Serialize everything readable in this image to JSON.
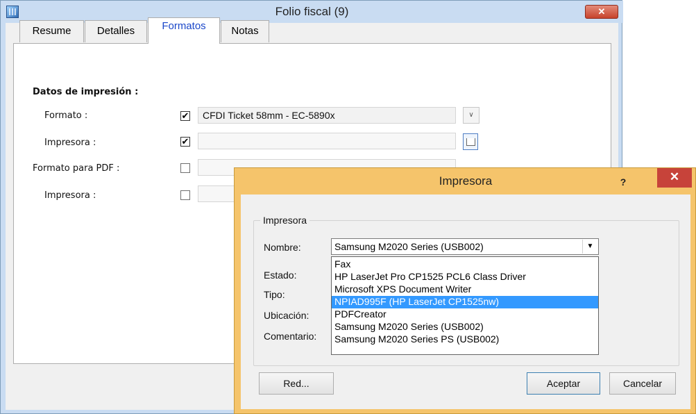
{
  "main_window": {
    "title": "Folio fiscal (9)",
    "close_glyph": "✕",
    "tabs": [
      {
        "label": "Resume",
        "active": false
      },
      {
        "label": "Detalles",
        "active": false
      },
      {
        "label": "Formatos",
        "active": true
      },
      {
        "label": "Notas",
        "active": false
      }
    ],
    "section_title": "Datos de impresión :",
    "rows": [
      {
        "label": "Formato :",
        "checked": true,
        "value": "CFDI Ticket 58mm - EC-5890x"
      },
      {
        "label": "Impresora :",
        "checked": true,
        "value": ""
      },
      {
        "label": "Formato para PDF :",
        "checked": false,
        "value": ""
      },
      {
        "label": "Impresora :",
        "checked": false,
        "value": ""
      }
    ],
    "check_glyph": "✔",
    "dropdown_glyph": "∨"
  },
  "dialog": {
    "title": "Impresora",
    "help_glyph": "?",
    "close_glyph": "✕",
    "group_label": "Impresora",
    "labels": {
      "nombre": "Nombre:",
      "estado": "Estado:",
      "tipo": "Tipo:",
      "ubicacion": "Ubicación:",
      "comentario": "Comentario:"
    },
    "selected_printer": "Samsung M2020 Series (USB002)",
    "select_arrow": "▼",
    "options": [
      "Fax",
      "HP LaserJet Pro CP1525 PCL6 Class Driver",
      "Microsoft XPS Document Writer",
      "NPIAD995F (HP LaserJet CP1525nw)",
      "PDFCreator",
      "Samsung M2020 Series (USB002)",
      "Samsung M2020 Series PS (USB002)"
    ],
    "highlighted_option": "NPIAD995F (HP LaserJet CP1525nw)",
    "buttons": {
      "network": "Red...",
      "accept": "Aceptar",
      "cancel": "Cancelar"
    }
  }
}
